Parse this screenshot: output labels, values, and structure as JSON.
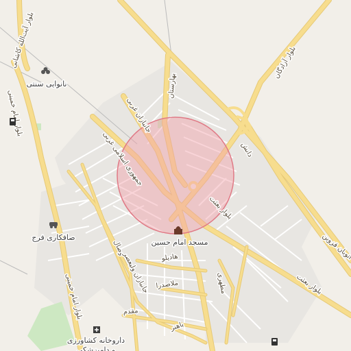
{
  "map": {
    "labels": {
      "emam_khomeini_blvd_north": "بلوار امام خمینی",
      "emam_khomeini_blvd_south": "بلوار امام خمینی",
      "ayatollah_kashani_blvd": "بلوار آیت‌الله کاشانی",
      "azadegan_blvd": "بلوار آزادگان",
      "baharestan": "بهارستان",
      "jomhuri_eslami_gharbi": "جمهوری اسلامی غربی",
      "janbazan_gharbi": "جانبازان غربی",
      "daneshgah": "دانش",
      "besat_blvd_1": "بلوار بعثت",
      "besat_blvd_2": "بلوار بعثت",
      "qazvin_highway": "اتوبان قزوین",
      "vesal": "وصال",
      "janbazan_valiasr": "جانبازان ولیعصر",
      "haftpeyvand": "هادیلو",
      "mollasadra": "ملاصدرا",
      "moghaddam": "مقدم",
      "bahonar": "باهنر",
      "motahari": "مطهری"
    },
    "pois": [
      {
        "id": "bakery",
        "label": "نانوایی سنتی",
        "icon": "bakery-icon"
      },
      {
        "id": "garage",
        "label": "صافکاری فرج",
        "icon": "car-repair-icon"
      },
      {
        "id": "mosque",
        "label": "مسجد امام حسین",
        "icon": "mosque-icon"
      },
      {
        "id": "pharmacy",
        "label_line1": "داروخانه کشاورزی",
        "label_line2": "و دامپزشکی",
        "icon": "pharmacy-icon"
      },
      {
        "id": "fuel_west",
        "label": "",
        "icon": "fuel-icon"
      },
      {
        "id": "fuel_south",
        "label": "",
        "icon": "fuel-icon"
      }
    ],
    "highlight_circle": {
      "color": "#f2a0a8",
      "stroke": "#e07a86"
    }
  }
}
